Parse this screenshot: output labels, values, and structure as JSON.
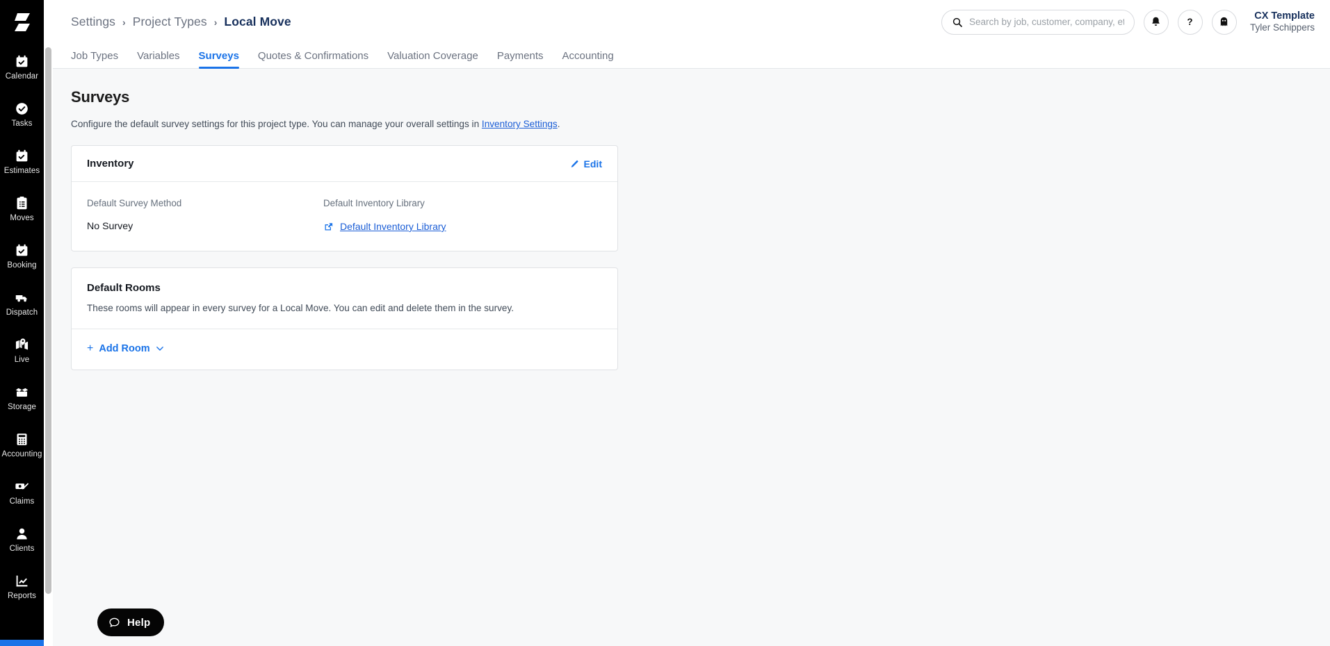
{
  "brand": {
    "logo_icon": "lightning-bolt-logo",
    "accent_color": "#1a73e8",
    "sidebar_bg": "#000000",
    "page_bg": "#f7f8f9",
    "link_color": "#1a5dd6",
    "breadcrumb_current_color": "#17305c"
  },
  "sidebar": {
    "items": [
      {
        "label": "Calendar",
        "icon": "calendar-check-icon"
      },
      {
        "label": "Tasks",
        "icon": "check-circle-icon"
      },
      {
        "label": "Estimates",
        "icon": "calendar-check-icon"
      },
      {
        "label": "Moves",
        "icon": "clipboard-list-icon"
      },
      {
        "label": "Booking",
        "icon": "calendar-check-icon"
      },
      {
        "label": "Dispatch",
        "icon": "truck-icon"
      },
      {
        "label": "Live",
        "icon": "map-pin-icon"
      },
      {
        "label": "Storage",
        "icon": "open-box-icon"
      },
      {
        "label": "Accounting",
        "icon": "calculator-icon"
      },
      {
        "label": "Claims",
        "icon": "money-edit-icon"
      },
      {
        "label": "Clients",
        "icon": "person-icon"
      },
      {
        "label": "Reports",
        "icon": "line-chart-icon"
      }
    ]
  },
  "header": {
    "breadcrumb": [
      {
        "label": "Settings",
        "current": false
      },
      {
        "label": "Project Types",
        "current": false
      },
      {
        "label": "Local Move",
        "current": true
      }
    ],
    "breadcrumb_separator": "›",
    "search": {
      "placeholder": "Search by job, customer, company, etc...",
      "value": "",
      "icon": "search-icon"
    },
    "actions": [
      {
        "icon": "bell-icon",
        "name": "notifications-button"
      },
      {
        "icon": "question-mark-icon",
        "name": "help-button"
      },
      {
        "icon": "ghost-icon",
        "name": "ghost-mode-button"
      }
    ],
    "user": {
      "company": "CX Template",
      "name": "Tyler Schippers"
    }
  },
  "tabs": [
    {
      "label": "Job Types",
      "active": false
    },
    {
      "label": "Variables",
      "active": false
    },
    {
      "label": "Surveys",
      "active": true
    },
    {
      "label": "Quotes & Confirmations",
      "active": false
    },
    {
      "label": "Valuation Coverage",
      "active": false
    },
    {
      "label": "Payments",
      "active": false
    },
    {
      "label": "Accounting",
      "active": false
    }
  ],
  "page": {
    "title": "Surveys",
    "description_before": "Configure the default survey settings for this project type. You can manage your overall settings in ",
    "description_link": "Inventory Settings",
    "description_after": "."
  },
  "inventory_card": {
    "title": "Inventory",
    "edit_label": "Edit",
    "edit_icon": "pencil-icon",
    "fields": [
      {
        "label": "Default Survey Method",
        "value": "No Survey",
        "type": "text"
      },
      {
        "label": "Default Inventory Library",
        "value": "Default Inventory Library",
        "type": "link",
        "icon": "external-link-icon"
      }
    ]
  },
  "default_rooms_card": {
    "title": "Default Rooms",
    "description": "These rooms will appear in every survey for a Local Move. You can edit and delete them in the survey.",
    "add_room_label": "Add Room",
    "add_icon": "plus-icon",
    "chevron_icon": "chevron-down-icon",
    "rooms": []
  },
  "help_widget": {
    "label": "Help",
    "icon": "speech-bubble-icon"
  }
}
